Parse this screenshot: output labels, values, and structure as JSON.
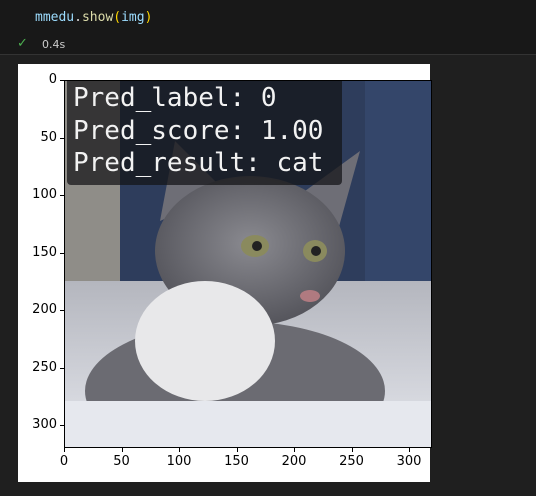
{
  "cell": {
    "code": {
      "obj": "mmedu",
      "dot": ".",
      "fn": "show",
      "open": "(",
      "arg": "img",
      "close": ")"
    },
    "status_icon": "check-icon",
    "duration": "0.4s"
  },
  "output": {
    "overlay_lines": [
      "Pred_label: 0",
      "Pred_score: 1.00",
      "Pred_result: cat"
    ],
    "x_ticks": [
      "0",
      "50",
      "100",
      "150",
      "200",
      "250",
      "300"
    ],
    "y_ticks": [
      "0",
      "50",
      "100",
      "150",
      "200",
      "250",
      "300"
    ],
    "x_tick_values": [
      0,
      50,
      100,
      150,
      200,
      250,
      300
    ],
    "y_tick_values": [
      0,
      50,
      100,
      150,
      200,
      250,
      300
    ],
    "image_extent": [
      0,
      320
    ]
  }
}
